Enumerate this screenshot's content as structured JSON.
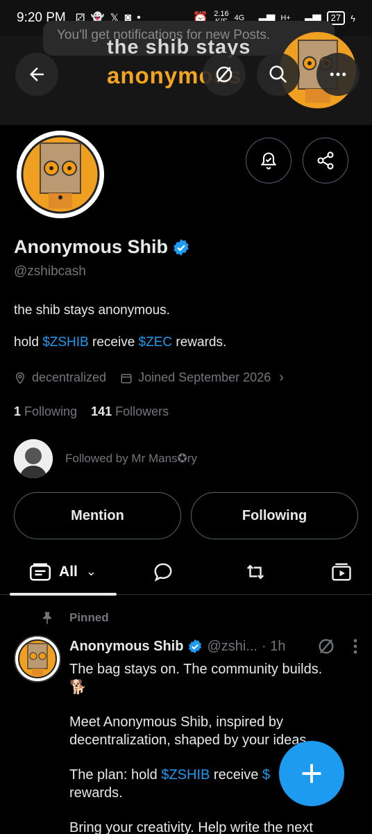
{
  "status_bar": {
    "time": "9:20 PM",
    "net_speed": "2.16",
    "net_unit": "K/S",
    "signal1": "4G",
    "signal2": "H+",
    "battery": "27"
  },
  "banner": {
    "toast": "You'll get notifications for new Posts.",
    "title": "the shib stays",
    "subtitle": "anonymous"
  },
  "profile": {
    "name": "Anonymous Shib",
    "handle": "@zshibcash",
    "bio_line1": "the shib stays anonymous.",
    "bio_line2": {
      "pre": "hold ",
      "tag1": "$ZSHIB",
      "mid": " receive ",
      "tag2": "$ZEC",
      "post": " rewards."
    },
    "location": "decentralized",
    "joined": "Joined September 2026",
    "following_count": "1",
    "following_label": "Following",
    "followers_count": "141",
    "followers_label": "Followers",
    "followed_by": "Followed by Mr Mans✪ry"
  },
  "actions": {
    "mention": "Mention",
    "following": "Following"
  },
  "tabs": {
    "all": "All"
  },
  "post": {
    "pinned": "Pinned",
    "name": "Anonymous Shib",
    "handle": "@zshi...",
    "time": "· 1h",
    "line1": "The bag stays on. The community builds.",
    "emoji": "🐕",
    "para2": "Meet Anonymous Shib, inspired by decentralization, shaped by your ideas.",
    "para3_pre": "The plan: hold ",
    "para3_tag1": "$ZSHIB",
    "para3_mid": " receive ",
    "para3_tag2": "$",
    "para3_post": "rewards.",
    "para4": "Bring your creativity. Help write the next"
  },
  "colors": {
    "accent": "#1d9bf0",
    "banner_text": "#f3a51f",
    "muted": "#71767b"
  }
}
